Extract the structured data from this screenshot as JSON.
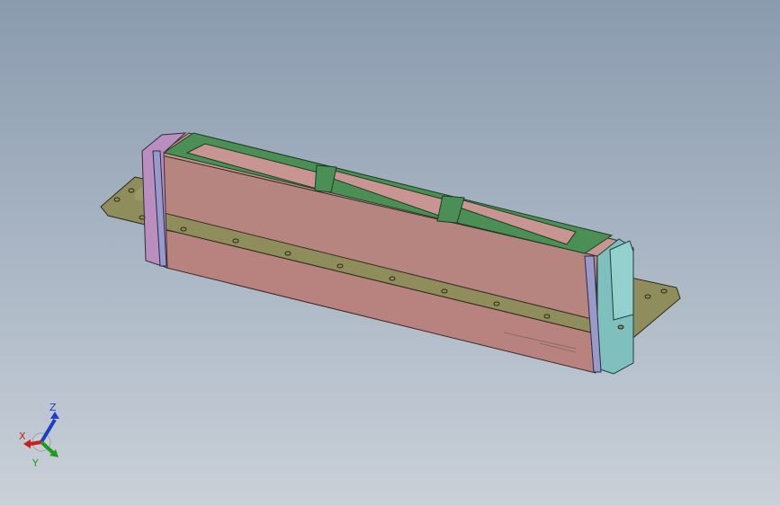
{
  "viewport": {
    "background_top": "#8a9bae",
    "background_bottom": "#c9d0d8"
  },
  "model": {
    "flange_color": "#8f8d5c",
    "body_color": "#b88884",
    "frame_color": "#4c8f56",
    "end_cap_left_color": "#b98fbf",
    "end_cap_right_color": "#7fc0be",
    "gasket_color": "#9a9ac8"
  },
  "triad": {
    "x_label": "X",
    "y_label": "Y",
    "z_label": "Z",
    "x_color": "#c81e1e",
    "y_color": "#1e9a1e",
    "z_color": "#1e3ec8"
  }
}
